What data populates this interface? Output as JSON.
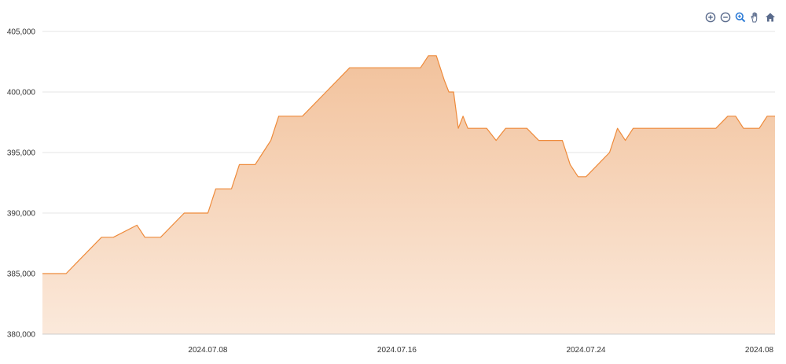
{
  "toolbar": {
    "tools": [
      {
        "name": "zoom-in-icon"
      },
      {
        "name": "zoom-out-icon"
      },
      {
        "name": "zoom-select-icon"
      },
      {
        "name": "pan-icon"
      },
      {
        "name": "home-icon"
      }
    ]
  },
  "colors": {
    "line": "#ee8a3a",
    "fill_top": "#f2c29c",
    "fill_bottom": "#fbe9db",
    "grid": "#e6e6e6",
    "icon": "#5a6b8c"
  },
  "chart_data": {
    "type": "area",
    "title": "",
    "xlabel": "",
    "ylabel": "",
    "xlim": [
      "2024-07-01",
      "2024-08-01"
    ],
    "ylim": [
      380000,
      405000
    ],
    "grid": true,
    "yticks": [
      380000,
      385000,
      390000,
      395000,
      400000,
      405000
    ],
    "ytick_labels": [
      "380,000",
      "385,000",
      "390,000",
      "395,000",
      "400,000",
      "405,000"
    ],
    "xticks": [
      "2024-07-08",
      "2024-07-16",
      "2024-07-24",
      "2024-08-01"
    ],
    "xtick_labels": [
      "2024.07.08",
      "2024.07.16",
      "2024.07.24",
      "2024.08"
    ],
    "x": [
      "2024-07-01",
      "2024-07-02",
      "2024-07-02",
      "2024-07-03",
      "2024-07-03",
      "2024-07-04",
      "2024-07-05",
      "2024-07-05",
      "2024-07-05",
      "2024-07-06",
      "2024-07-07",
      "2024-07-07",
      "2024-07-08",
      "2024-07-08",
      "2024-07-08",
      "2024-07-09",
      "2024-07-09",
      "2024-07-09",
      "2024-07-10",
      "2024-07-10",
      "2024-07-10",
      "2024-07-11",
      "2024-07-12",
      "2024-07-13",
      "2024-07-14",
      "2024-07-15",
      "2024-07-15",
      "2024-07-16",
      "2024-07-16",
      "2024-07-17",
      "2024-07-17",
      "2024-07-17",
      "2024-07-18",
      "2024-07-18",
      "2024-07-18",
      "2024-07-18",
      "2024-07-18",
      "2024-07-19",
      "2024-07-19",
      "2024-07-19",
      "2024-07-19",
      "2024-07-19",
      "2024-07-21",
      "2024-07-21",
      "2024-07-22",
      "2024-07-23",
      "2024-07-23",
      "2024-07-23",
      "2024-07-24",
      "2024-07-25",
      "2024-07-25",
      "2024-07-25",
      "2024-07-26",
      "2024-07-27",
      "2024-07-28",
      "2024-07-29",
      "2024-07-29",
      "2024-07-30",
      "2024-07-30",
      "2024-07-30",
      "2024-07-31",
      "2024-07-31",
      "2024-07-31",
      "2024-08-01"
    ],
    "values": [
      385000,
      385000,
      386000,
      387000,
      388000,
      388000,
      389000,
      388000,
      388000,
      388000,
      390000,
      390000,
      390000,
      392000,
      392000,
      392000,
      394000,
      394000,
      394000,
      395000,
      396000,
      398000,
      398000,
      400000,
      402000,
      402000,
      402000,
      402000,
      402000,
      402000,
      403000,
      403000,
      401000,
      400000,
      400000,
      397000,
      398000,
      397000,
      397000,
      397000,
      396000,
      397000,
      397000,
      397000,
      396000,
      396000,
      394000,
      393000,
      393000,
      395000,
      397000,
      396000,
      397000,
      397000,
      397000,
      397000,
      397000,
      398000,
      398000,
      397000,
      397000,
      397000,
      398000,
      398000
    ],
    "series": [
      {
        "values": []
      }
    ]
  }
}
